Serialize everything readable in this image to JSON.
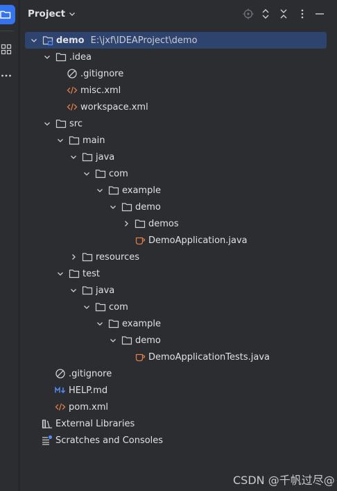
{
  "stripe": {
    "active": "project-folder-icon",
    "items": [
      "project-folder-icon",
      "structure-icon",
      "more-icon"
    ]
  },
  "header": {
    "title": "Project",
    "icons": [
      "locate-icon",
      "expand-all-icon",
      "collapse-all-icon",
      "options-icon",
      "hide-icon"
    ]
  },
  "tree": {
    "root": {
      "label": "demo",
      "path": "E:\\jxf\\IDEAProject\\demo"
    },
    "idea": "idea",
    "idea_gitignore": ".gitignore",
    "misc": "misc.xml",
    "workspace": "workspace.xml",
    "src": "src",
    "main": "main",
    "main_java": "java",
    "main_com": "com",
    "main_example": "example",
    "main_demo": "demo",
    "demos": "demos",
    "app": "DemoApplication.java",
    "resources": "resources",
    "test": "test",
    "test_java": "java",
    "test_com": "com",
    "test_example": "example",
    "test_demo": "demo",
    "app_tests": "DemoApplicationTests.java",
    "root_gitignore": ".gitignore",
    "help": "HELP.md",
    "pom": "pom.xml",
    "external": "External Libraries",
    "scratches": "Scratches and Consoles"
  },
  "watermark": "CSDN @千帆过尽@",
  "colors": {
    "background": "#2b2d30",
    "selection": "#2e436e",
    "accent": "#3574f0",
    "xml": "#e27d4a",
    "java": "#e27d4a",
    "markdown": "#548af7"
  }
}
